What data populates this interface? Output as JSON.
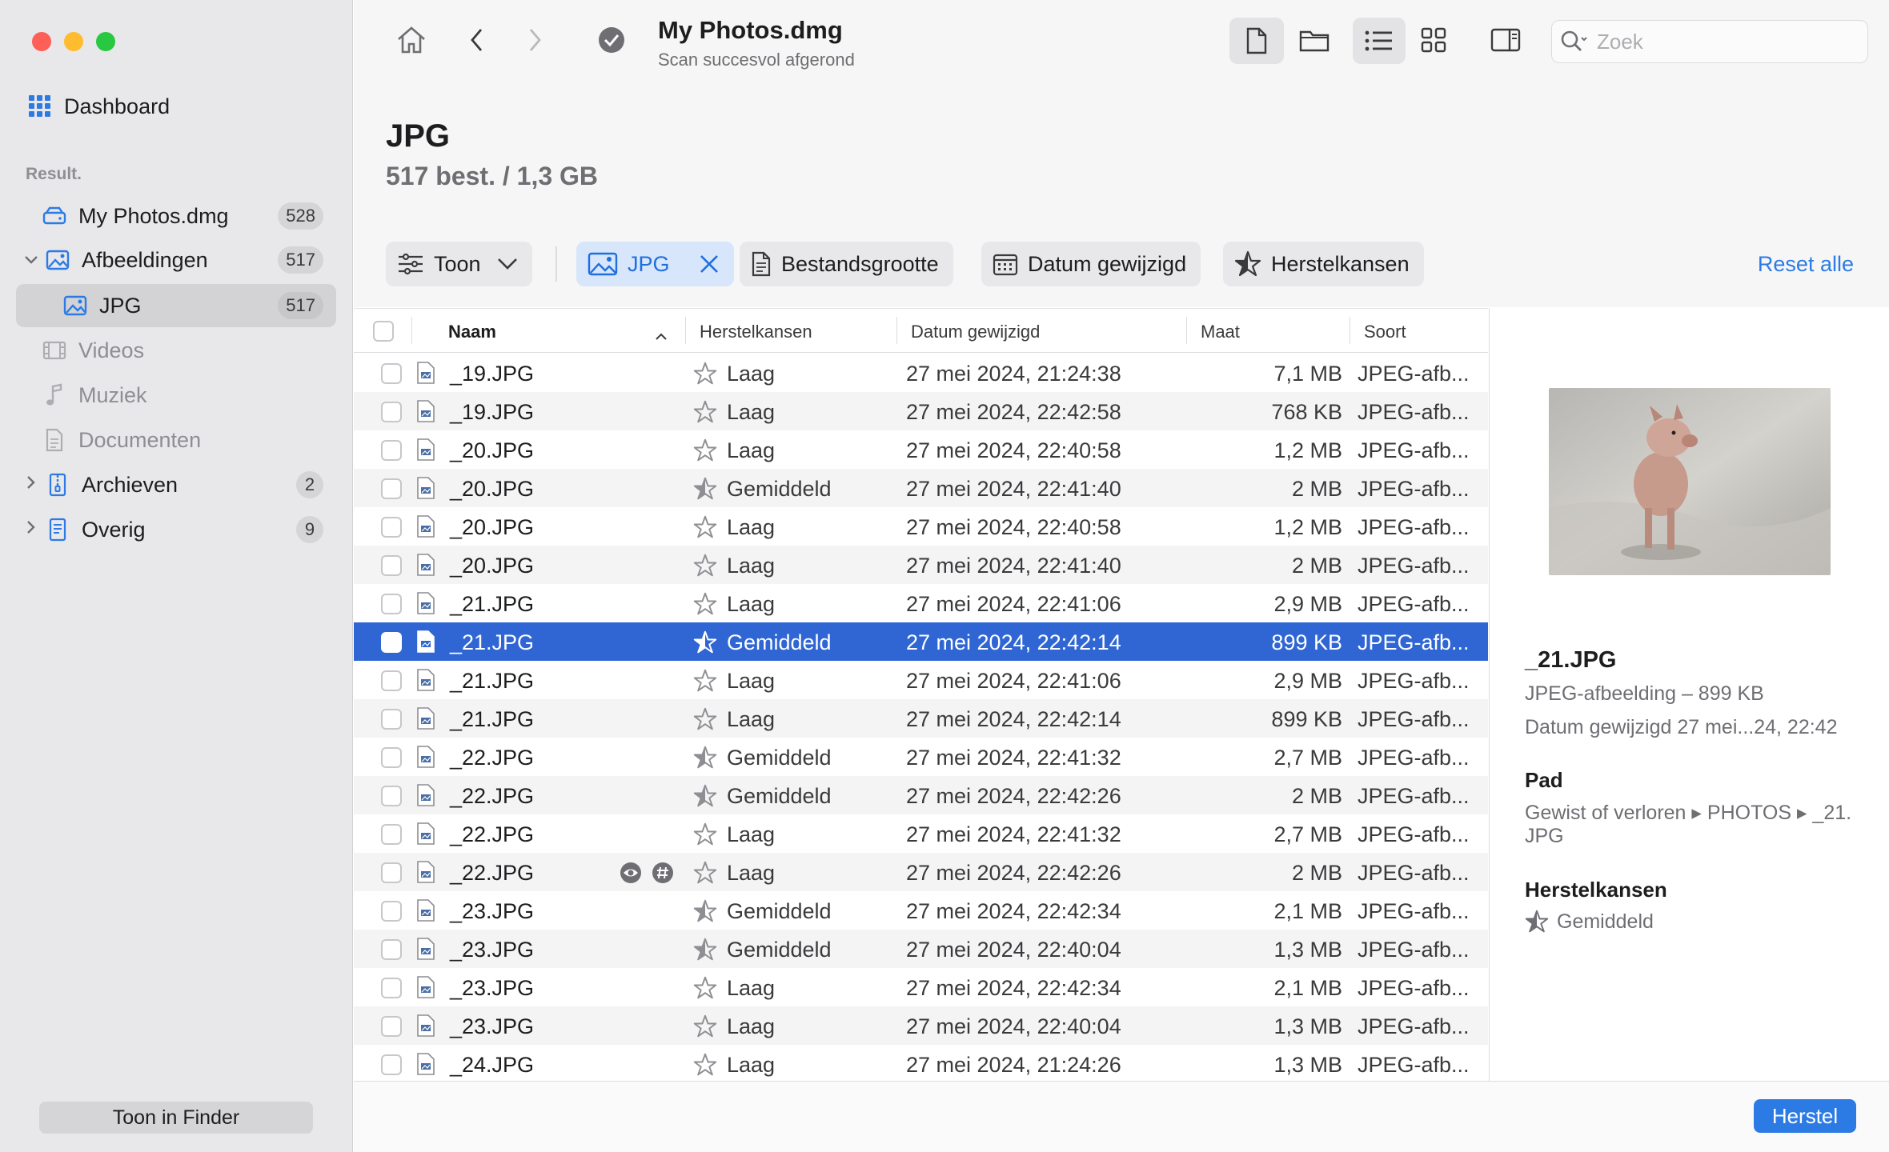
{
  "sidebar": {
    "dashboard": "Dashboard",
    "section": "Result.",
    "items": [
      {
        "label": "My Photos.dmg",
        "count": "528"
      },
      {
        "label": "Afbeeldingen",
        "count": "517"
      },
      {
        "label": "JPG",
        "count": "517"
      },
      {
        "label": "Videos"
      },
      {
        "label": "Muziek"
      },
      {
        "label": "Documenten"
      },
      {
        "label": "Archieven",
        "count": "2"
      },
      {
        "label": "Overig",
        "count": "9"
      }
    ],
    "finder_button": "Toon in Finder"
  },
  "toolbar": {
    "title": "My Photos.dmg",
    "subtitle": "Scan succesvol afgerond",
    "search_placeholder": "Zoek"
  },
  "header": {
    "title": "JPG",
    "subtitle": "517 best. / 1,3 GB",
    "filters": {
      "show": "Toon",
      "jpg": "JPG",
      "size": "Bestandsgrootte",
      "date": "Datum gewijzigd",
      "chances": "Herstelkansen"
    },
    "reset": "Reset alle"
  },
  "table": {
    "columns": {
      "name": "Naam",
      "chances": "Herstelkansen",
      "date": "Datum gewijzigd",
      "size": "Maat",
      "kind": "Soort"
    },
    "rows": [
      {
        "name": "_19.JPG",
        "chance": "Laag",
        "date": "27 mei 2024, 21:24:38",
        "size": "7,1 MB",
        "kind": "JPEG-afb..."
      },
      {
        "name": "_19.JPG",
        "chance": "Laag",
        "date": "27 mei 2024, 22:42:58",
        "size": "768 KB",
        "kind": "JPEG-afb..."
      },
      {
        "name": "_20.JPG",
        "chance": "Laag",
        "date": "27 mei 2024, 22:40:58",
        "size": "1,2 MB",
        "kind": "JPEG-afb..."
      },
      {
        "name": "_20.JPG",
        "chance": "Gemiddeld",
        "date": "27 mei 2024, 22:41:40",
        "size": "2 MB",
        "kind": "JPEG-afb..."
      },
      {
        "name": "_20.JPG",
        "chance": "Laag",
        "date": "27 mei 2024, 22:40:58",
        "size": "1,2 MB",
        "kind": "JPEG-afb..."
      },
      {
        "name": "_20.JPG",
        "chance": "Laag",
        "date": "27 mei 2024, 22:41:40",
        "size": "2 MB",
        "kind": "JPEG-afb..."
      },
      {
        "name": "_21.JPG",
        "chance": "Laag",
        "date": "27 mei 2024, 22:41:06",
        "size": "2,9 MB",
        "kind": "JPEG-afb..."
      },
      {
        "name": "_21.JPG",
        "chance": "Gemiddeld",
        "date": "27 mei 2024, 22:42:14",
        "size": "899 KB",
        "kind": "JPEG-afb...",
        "selected": true
      },
      {
        "name": "_21.JPG",
        "chance": "Laag",
        "date": "27 mei 2024, 22:41:06",
        "size": "2,9 MB",
        "kind": "JPEG-afb..."
      },
      {
        "name": "_21.JPG",
        "chance": "Laag",
        "date": "27 mei 2024, 22:42:14",
        "size": "899 KB",
        "kind": "JPEG-afb..."
      },
      {
        "name": "_22.JPG",
        "chance": "Gemiddeld",
        "date": "27 mei 2024, 22:41:32",
        "size": "2,7 MB",
        "kind": "JPEG-afb..."
      },
      {
        "name": "_22.JPG",
        "chance": "Gemiddeld",
        "date": "27 mei 2024, 22:42:26",
        "size": "2 MB",
        "kind": "JPEG-afb..."
      },
      {
        "name": "_22.JPG",
        "chance": "Laag",
        "date": "27 mei 2024, 22:41:32",
        "size": "2,7 MB",
        "kind": "JPEG-afb..."
      },
      {
        "name": "_22.JPG",
        "chance": "Laag",
        "date": "27 mei 2024, 22:42:26",
        "size": "2 MB",
        "kind": "JPEG-afb...",
        "hover": true
      },
      {
        "name": "_23.JPG",
        "chance": "Gemiddeld",
        "date": "27 mei 2024, 22:42:34",
        "size": "2,1 MB",
        "kind": "JPEG-afb..."
      },
      {
        "name": "_23.JPG",
        "chance": "Gemiddeld",
        "date": "27 mei 2024, 22:40:04",
        "size": "1,3 MB",
        "kind": "JPEG-afb..."
      },
      {
        "name": "_23.JPG",
        "chance": "Laag",
        "date": "27 mei 2024, 22:42:34",
        "size": "2,1 MB",
        "kind": "JPEG-afb..."
      },
      {
        "name": "_23.JPG",
        "chance": "Laag",
        "date": "27 mei 2024, 22:40:04",
        "size": "1,3 MB",
        "kind": "JPEG-afb..."
      },
      {
        "name": "_24.JPG",
        "chance": "Laag",
        "date": "27 mei 2024, 21:24:26",
        "size": "1,3 MB",
        "kind": "JPEG-afb..."
      }
    ]
  },
  "preview": {
    "name": "_21.JPG",
    "type": "JPEG-afbeelding – 899 KB",
    "modified": "Datum gewijzigd  27 mei...24, 22:42",
    "path_heading": "Pad",
    "path_line1": "Gewist of verloren ▸ PHOTOS ▸ _21.",
    "path_line2": "JPG",
    "chances_heading": "Herstelkansen",
    "chance": "Gemiddeld"
  },
  "bottom": {
    "recover": "Herstel"
  },
  "colors": {
    "accent": "#2c7be5",
    "selection": "#2f66d3"
  }
}
